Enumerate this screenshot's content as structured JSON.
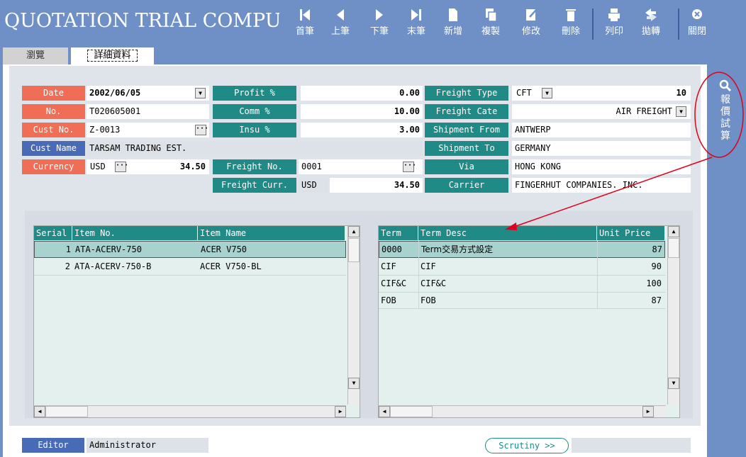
{
  "app": {
    "title": "QUOTATION TRIAL COMPUTE"
  },
  "toolbar": [
    {
      "label": "首筆",
      "icon": "first-record-icon"
    },
    {
      "label": "上筆",
      "icon": "previous-record-icon"
    },
    {
      "label": "下筆",
      "icon": "next-record-icon"
    },
    {
      "label": "末筆",
      "icon": "last-record-icon"
    },
    {
      "label": "新增",
      "icon": "new-document-icon"
    },
    {
      "label": "複製",
      "icon": "copy-icon"
    },
    {
      "label": "修改",
      "icon": "edit-icon"
    },
    {
      "label": "刪除",
      "icon": "delete-icon"
    },
    {
      "label": "列印",
      "icon": "print-icon"
    },
    {
      "label": "拋轉",
      "icon": "transfer-icon"
    },
    {
      "label": "關閉",
      "icon": "close-icon"
    }
  ],
  "tabs": {
    "browse": "瀏覽",
    "detail": "詳細資料"
  },
  "form": {
    "date": {
      "label": "Date",
      "value": "2002/06/05"
    },
    "no": {
      "label": "No.",
      "value": "T020605001"
    },
    "cust_no": {
      "label": "Cust No.",
      "value": "Z-0013"
    },
    "cust_name": {
      "label": "Cust Name",
      "value": "TARSAM TRADING EST."
    },
    "currency": {
      "label": "Currency",
      "code": "USD",
      "rate": "34.50"
    },
    "profit": {
      "label": "Profit %",
      "value": "0.00"
    },
    "comm": {
      "label": "Comm %",
      "value": "10.00"
    },
    "insu": {
      "label": "Insu %",
      "value": "3.00"
    },
    "freight_no": {
      "label": "Freight No.",
      "value": "0001"
    },
    "freight_curr": {
      "label": "Freight Curr.",
      "code": "USD",
      "rate": "34.50"
    },
    "freight_type": {
      "label": "Freight Type",
      "code": "CFT",
      "value": "10"
    },
    "freight_cate": {
      "label": "Freight Cate",
      "value": "AIR FREIGHT"
    },
    "shipment_from": {
      "label": "Shipment From",
      "value": "ANTWERP"
    },
    "shipment_to": {
      "label": "Shipment To",
      "value": "GERMANY"
    },
    "via": {
      "label": "Via",
      "value": "HONG KONG"
    },
    "carrier": {
      "label": "Carrier",
      "value": "FINGERHUT COMPANIES. INC."
    }
  },
  "items_grid": {
    "headers": [
      "Serial",
      "Item No.",
      "Item Name"
    ],
    "rows": [
      {
        "serial": "1",
        "item_no": "ATA-ACERV-750",
        "item_name": "ACER V750"
      },
      {
        "serial": "2",
        "item_no": "ATA-ACERV-750-B",
        "item_name": "ACER V750-BL"
      }
    ]
  },
  "terms_grid": {
    "headers": [
      "Term",
      "Term Desc",
      "Unit Price"
    ],
    "rows": [
      {
        "term": "0000",
        "desc": "Term交易方式設定",
        "price": "87"
      },
      {
        "term": "CIF",
        "desc": "CIF",
        "price": "90"
      },
      {
        "term": "CIF&C",
        "desc": "CIF&C",
        "price": "100"
      },
      {
        "term": "FOB",
        "desc": "FOB",
        "price": "87"
      }
    ]
  },
  "footer": {
    "editor_label": "Editor",
    "editor_value": "Administrator",
    "scrutiny": "Scrutiny >>"
  },
  "side": {
    "search_label": "報價試算"
  },
  "colors": {
    "header_bg": "#6f8fc7",
    "teal": "#1f8a86",
    "salmon": "#f06d56",
    "annotation": "#e0001a"
  }
}
